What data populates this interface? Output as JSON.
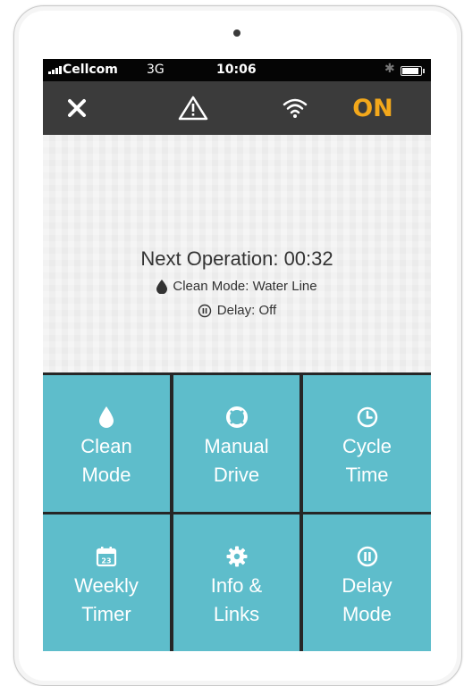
{
  "status_bar": {
    "carrier": "Cellcom",
    "network": "3G",
    "time": "10:06",
    "battery_level": 0.9
  },
  "app_bar": {
    "close_icon": "close-icon",
    "warning_icon": "warning-icon",
    "wifi_icon": "wifi-icon",
    "power_state": "ON",
    "power_color": "#f3a81b"
  },
  "status_panel": {
    "next_operation": "Next Operation: 00:32",
    "clean_mode": "Clean Mode: Water Line",
    "delay": "Delay: Off"
  },
  "tiles": [
    {
      "line1": "Clean",
      "line2": "Mode",
      "icon": "droplet-icon"
    },
    {
      "line1": "Manual",
      "line2": "Drive",
      "icon": "lifebuoy-icon"
    },
    {
      "line1": "Cycle",
      "line2": "Time",
      "icon": "clock-icon"
    },
    {
      "line1": "Weekly",
      "line2": "Timer",
      "icon": "calendar-icon",
      "calendar_day": "23"
    },
    {
      "line1": "Info &",
      "line2": "Links",
      "icon": "gear-icon"
    },
    {
      "line1": "Delay",
      "line2": "Mode",
      "icon": "pause-icon"
    }
  ],
  "colors": {
    "tile": "#5ebdcb",
    "app_bar": "#3b3b3b",
    "accent": "#f3a81b"
  }
}
